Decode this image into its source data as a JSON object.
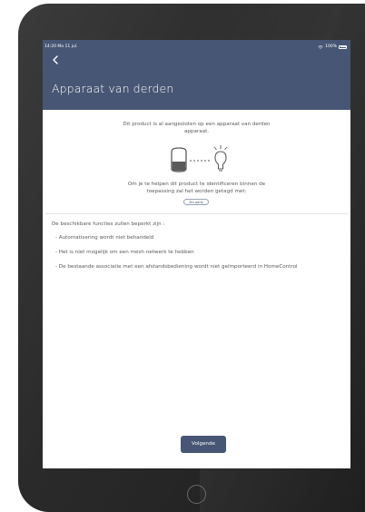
{
  "status_bar": {
    "time": "14:20",
    "date": "Ma 11 jul.",
    "battery": "100%"
  },
  "header": {
    "back_icon": "chevron-left-icon",
    "title": "Apparaat van derden"
  },
  "intro": {
    "line1": "Dit product is al aangesloten op een apparaat van derden",
    "line2": "apparaat."
  },
  "illustration": {
    "left_icon": "smart-speaker-icon",
    "right_icon": "light-bulb-icon"
  },
  "help": {
    "line1": "Om je te helpen dit product te identificeren binnen de",
    "line2": "toepassing zal het worden getagd met:",
    "tag_label": "3rd party"
  },
  "functions": {
    "heading": "De beschikbare functies zullen beperkt zijn :",
    "items": [
      "- Automatisering wordt niet behandeld",
      "- Het is niet mogelijk om een mesh netwerk te hebben",
      "- De bestaande associatie met een afstandsbediening wordt niet geïmporteerd in HomeControl"
    ]
  },
  "footer": {
    "next_label": "Volgende"
  },
  "colors": {
    "header_bg": "#475674",
    "button_bg": "#475674",
    "text": "#5a5a5a",
    "device_frame": "#2e2e2e"
  }
}
